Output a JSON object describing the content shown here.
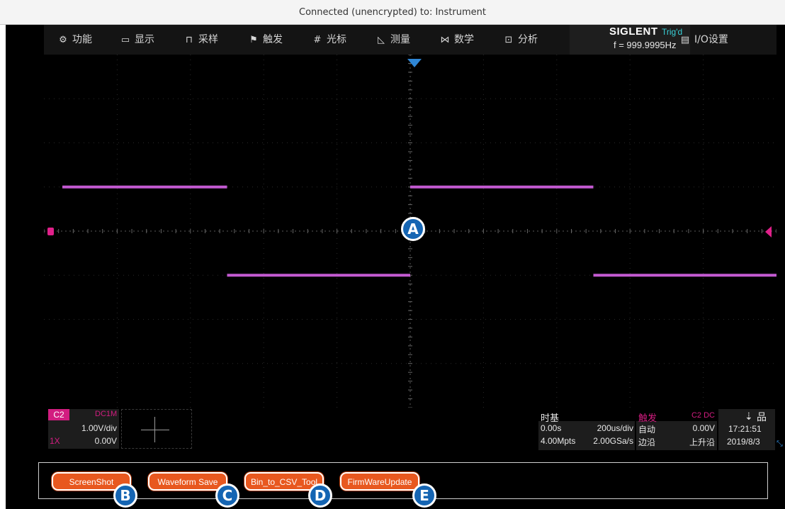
{
  "window": {
    "title": "Connected (unencrypted) to: Instrument"
  },
  "menu": {
    "items": [
      {
        "label": "功能",
        "icon": "gear-icon"
      },
      {
        "label": "显示",
        "icon": "monitor-icon"
      },
      {
        "label": "采样",
        "icon": "acquire-icon"
      },
      {
        "label": "触发",
        "icon": "flag-icon"
      },
      {
        "label": "光标",
        "icon": "cursor-hash-icon"
      },
      {
        "label": "测量",
        "icon": "ruler-icon"
      },
      {
        "label": "数学",
        "icon": "math-icon"
      },
      {
        "label": "分析",
        "icon": "analyze-icon"
      }
    ],
    "brand": "SIGLENT",
    "trig_status": "Trig'd",
    "frequency": "f = 999.9995Hz",
    "io_label": "I/O设置"
  },
  "waveform": {
    "channel": "C2",
    "color": "#c35ad1",
    "type": "square",
    "high_level_div": 1,
    "low_level_div": -1,
    "period_div": 5
  },
  "channel_info": {
    "tag": "C2",
    "coupling": "DC1M",
    "scale": "1.00V/div",
    "probe": "1X",
    "offset": "0.00V"
  },
  "timebase": {
    "title": "时基",
    "delay": "0.00s",
    "scale": "200us/div",
    "memory": "4.00Mpts",
    "sample_rate": "2.00GSa/s"
  },
  "trigger": {
    "title": "触发",
    "source": "C2 DC",
    "mode": "自动",
    "level": "0.00V",
    "type": "边沿",
    "slope": "上升沿"
  },
  "status": {
    "time": "17:21:51",
    "date": "2019/8/3"
  },
  "buttons": {
    "screenshot": "ScreenShot",
    "waveform_save": "Waveform Save",
    "bin_to_csv": "Bin_to_CSV_Tool",
    "firmware_update": "FirmWareUpdate"
  },
  "callouts": {
    "a": "A",
    "b": "B",
    "c": "C",
    "d": "D",
    "e": "E"
  },
  "colors": {
    "accent_button": "#e8581f",
    "channel2": "#d21d80",
    "trigger_marker": "#2f87d6",
    "callout": "#1565b3"
  }
}
